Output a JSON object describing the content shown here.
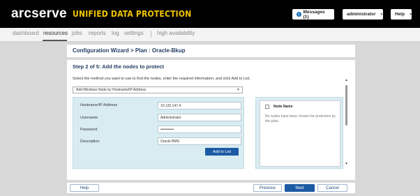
{
  "header": {
    "logo": "arcserve",
    "product": "UNIFIED DATA PROTECTION",
    "messages_label": "Messages (1)",
    "user_label": "administrator",
    "help_label": "Help"
  },
  "nav": {
    "items": [
      "dashboard",
      "resources",
      "jobs",
      "reports",
      "log",
      "settings",
      "high availability"
    ],
    "active": "resources"
  },
  "wizard": {
    "title": "Configuration Wizard > Plan : Oracle-Bkup",
    "step_title": "Step 2 of 5: Add the nodes to protect",
    "instructions": "Select the method you want to use to find the nodes, enter the required information, and click Add to List.",
    "method_selected": "Add Windows Node by Hostname/IP Address"
  },
  "form": {
    "hostname_label": "Hostname/IP Address",
    "hostname_value": "10.132.147.4",
    "username_label": "Username",
    "username_value": "Administrator",
    "password_label": "Password",
    "password_value": "•••••••••••",
    "description_label": "Description",
    "description_value": "Oracle BMS",
    "add_button": "Add to List"
  },
  "node_list": {
    "column_header": "Node Name",
    "empty_text": "No nodes have been chosen for protection by this plan."
  },
  "footer": {
    "help": "Help",
    "previous": "Previous",
    "next": "Next",
    "cancel": "Cancel"
  },
  "colors": {
    "header_bg": "#000000",
    "product_accent": "#f0c400",
    "primary_button": "#1c5aa3",
    "panel_bg": "#d8ecf2"
  }
}
